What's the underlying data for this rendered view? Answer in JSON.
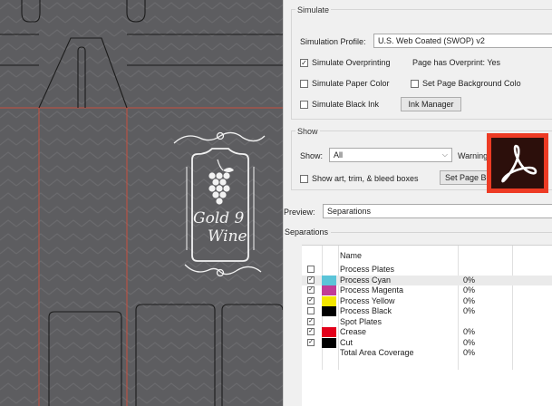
{
  "artwork": {
    "logo": {
      "line1": "Gold 9",
      "line2": "Wine"
    },
    "colors": {
      "background": "#5d5d60",
      "crease_line": "#d0503c",
      "cut_line": "#1a1a1a",
      "logo": "#f2f2f2"
    }
  },
  "panel": {
    "simulate": {
      "title": "Simulate",
      "profile_label": "Simulation Profile:",
      "profile_value": "U.S. Web Coated (SWOP) v2",
      "simulate_overprinting": {
        "label": "Simulate Overprinting",
        "checked": true
      },
      "overprint_status": "Page has Overprint:  Yes",
      "simulate_paper_color": {
        "label": "Simulate Paper Color",
        "checked": false
      },
      "set_page_background": {
        "label": "Set Page Background Colo",
        "checked": false
      },
      "simulate_black_ink": {
        "label": "Simulate Black Ink",
        "checked": false
      },
      "ink_manager_label": "Ink Manager"
    },
    "show": {
      "title": "Show",
      "show_label": "Show:",
      "show_value": "All",
      "warning_label": "Warning",
      "show_boxes": {
        "label": "Show art, trim, & bleed boxes",
        "checked": false
      },
      "set_page_boxes_label": "Set Page Bo"
    },
    "preview": {
      "label": "Preview:",
      "value": "Separations"
    },
    "separations": {
      "title": "Separations",
      "header_name": "Name",
      "rows": [
        {
          "name": "Process Plates",
          "checked": false,
          "color": "",
          "pct": "",
          "selected": false
        },
        {
          "name": "Process Cyan",
          "checked": true,
          "color": "#5bc4d8",
          "pct": "0%",
          "selected": true
        },
        {
          "name": "Process Magenta",
          "checked": true,
          "color": "#c13c97",
          "pct": "0%",
          "selected": false
        },
        {
          "name": "Process Yellow",
          "checked": true,
          "color": "#f3e600",
          "pct": "0%",
          "selected": false
        },
        {
          "name": "Process Black",
          "checked": false,
          "color": "#000000",
          "pct": "0%",
          "selected": false
        },
        {
          "name": "Spot Plates",
          "checked": true,
          "color": "",
          "pct": "",
          "selected": false
        },
        {
          "name": "Crease",
          "checked": true,
          "color": "#e3001b",
          "pct": "0%",
          "selected": false
        },
        {
          "name": "Cut",
          "checked": true,
          "color": "#000000",
          "pct": "0%",
          "selected": false
        },
        {
          "name": "Total Area Coverage",
          "checked": null,
          "color": "",
          "pct": "0%",
          "selected": false
        }
      ]
    }
  },
  "acrobat_icon": {
    "icon": "adobe-acrobat-icon",
    "colors": {
      "border": "#ed3b24",
      "inner": "#2c0f0b",
      "glyph": "#ffffff"
    }
  }
}
